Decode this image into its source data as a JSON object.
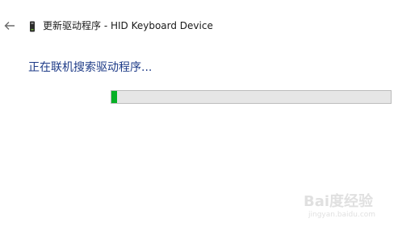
{
  "header": {
    "title": "更新驱动程序 - HID Keyboard Device"
  },
  "main": {
    "status_text": "正在联机搜索驱动程序...",
    "progress": 0.02
  },
  "watermark": {
    "text": "Bai度经验",
    "subtext": "jingyan.baidu.com"
  },
  "colors": {
    "accent_text": "#1f3c88",
    "progress_fill": "#06b025",
    "progress_track": "#e6e6e6"
  },
  "icons": {
    "back": "back-arrow-icon",
    "device": "keyboard-device-icon"
  }
}
